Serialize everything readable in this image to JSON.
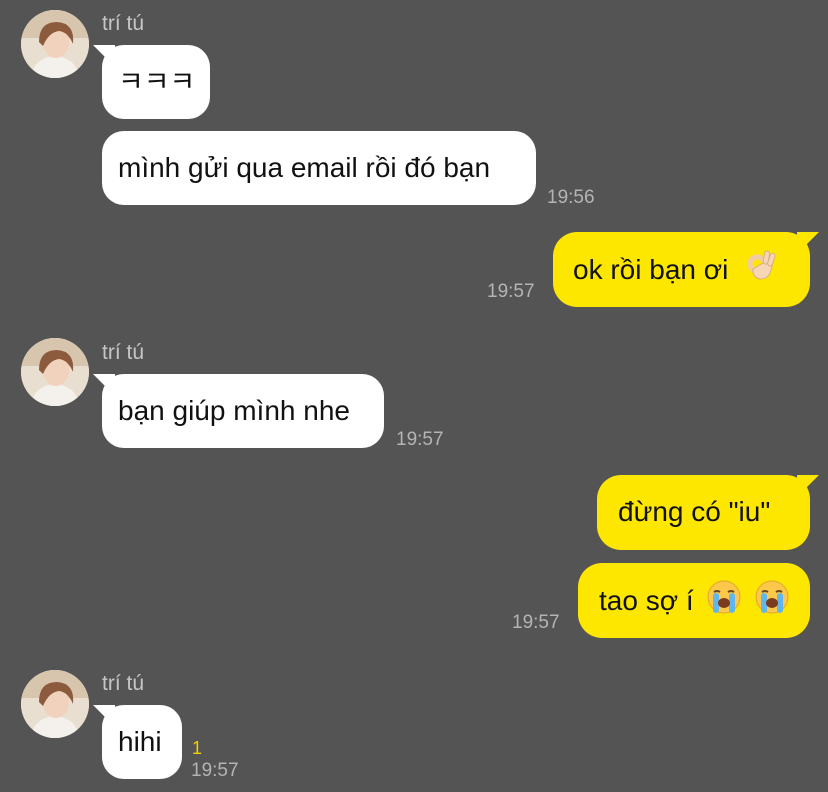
{
  "colors": {
    "background": "#545454",
    "incoming_bubble": "#ffffff",
    "outgoing_bubble": "#fde600",
    "timestamp": "#b4b4b4",
    "sender_name": "#c6c6c6",
    "unread_count": "#f2d100"
  },
  "messages": [
    {
      "direction": "incoming",
      "sender": "trí tú",
      "text": "ㅋㅋㅋ"
    },
    {
      "direction": "incoming",
      "text": "mình gửi qua email rồi đó bạn",
      "time": "19:56"
    },
    {
      "direction": "outgoing",
      "text": "ok rồi bạn ơi",
      "emoji": "ok-hand-icon",
      "time": "19:57"
    },
    {
      "direction": "incoming",
      "sender": "trí tú",
      "text": "bạn giúp mình nhe",
      "time": "19:57"
    },
    {
      "direction": "outgoing",
      "text": "đừng có \"iu\""
    },
    {
      "direction": "outgoing",
      "text": "tao sợ í",
      "emoji": "loudly-crying-face-icon x2",
      "time": "19:57"
    },
    {
      "direction": "incoming",
      "sender": "trí tú",
      "text": "hihi",
      "unread": "1",
      "time": "19:57"
    }
  ]
}
